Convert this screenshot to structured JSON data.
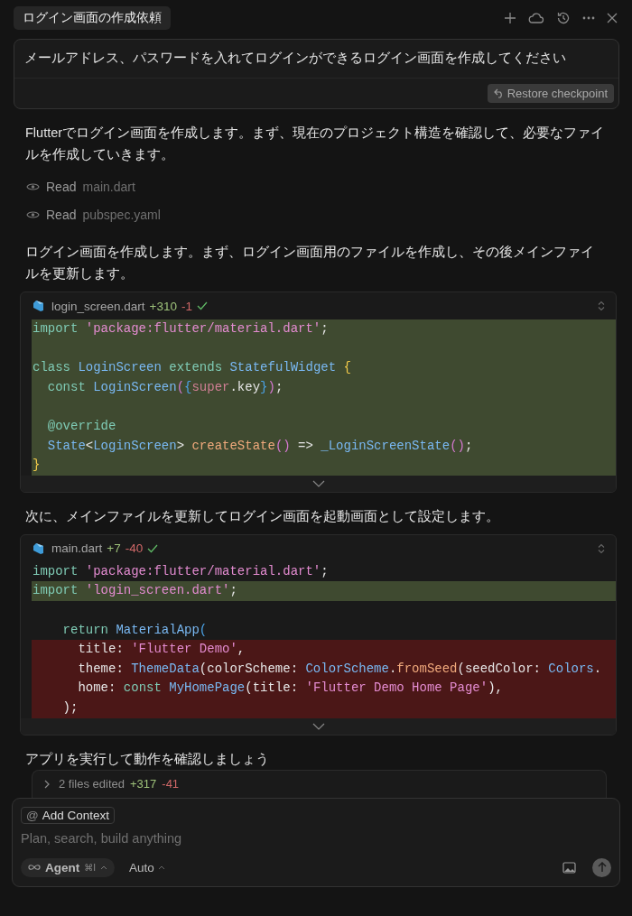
{
  "header": {
    "title": "ログイン画面の作成依頼"
  },
  "user_message": {
    "text": "メールアドレス、パスワードを入れてログインができるログイン画面を作成してください",
    "restore_button": "Restore checkpoint"
  },
  "messages": [
    {
      "kind": "text",
      "text": "Flutterでログイン画面を作成します。まず、現在のプロジェクト構造を確認して、必要なファイルを作成していきます。"
    },
    {
      "kind": "tool",
      "verb": "Read",
      "file": "main.dart"
    },
    {
      "kind": "tool",
      "verb": "Read",
      "file": "pubspec.yaml"
    },
    {
      "kind": "text",
      "text": "ログイン画面を作成します。まず、ログイン画面用のファイルを作成し、その後メインファイルを更新します。"
    },
    {
      "kind": "diff",
      "file": "login_screen.dart",
      "added": "+310",
      "removed": "-1",
      "applied": true,
      "lines": [
        {
          "kind": "added",
          "segments": [
            {
              "kind": "keyword",
              "text": "import "
            },
            {
              "kind": "string",
              "text": "'package:flutter/material.dart'"
            },
            {
              "kind": "plain",
              "text": ";"
            }
          ]
        },
        {
          "kind": "added"
        },
        {
          "kind": "added",
          "segments": [
            {
              "kind": "keyword",
              "text": "class "
            },
            {
              "kind": "type",
              "text": "LoginScreen "
            },
            {
              "kind": "keyword",
              "text": "extends "
            },
            {
              "kind": "type",
              "text": "StatefulWidget "
            },
            {
              "kind": "brace",
              "text": "{"
            }
          ]
        },
        {
          "kind": "added",
          "segments": [
            {
              "kind": "keyword",
              "text": "  const "
            },
            {
              "kind": "type",
              "text": "LoginScreen"
            },
            {
              "kind": "paren",
              "text": "("
            },
            {
              "kind": "brace2",
              "text": "{"
            },
            {
              "kind": "super",
              "text": "super"
            },
            {
              "kind": "plain",
              "text": ".key"
            },
            {
              "kind": "brace2",
              "text": "}"
            },
            {
              "kind": "paren",
              "text": ")"
            },
            {
              "kind": "plain",
              "text": ";"
            }
          ]
        },
        {
          "kind": "added"
        },
        {
          "kind": "added",
          "segments": [
            {
              "kind": "keyword",
              "text": "  @override"
            }
          ]
        },
        {
          "kind": "added",
          "segments": [
            {
              "kind": "type",
              "text": "  State"
            },
            {
              "kind": "plain",
              "text": "<"
            },
            {
              "kind": "type",
              "text": "LoginScreen"
            },
            {
              "kind": "plain",
              "text": "> "
            },
            {
              "kind": "function",
              "text": "createState"
            },
            {
              "kind": "paren",
              "text": "()"
            },
            {
              "kind": "plain",
              "text": " => "
            },
            {
              "kind": "type",
              "text": "_LoginScreenState"
            },
            {
              "kind": "paren",
              "text": "()"
            },
            {
              "kind": "plain",
              "text": ";"
            }
          ]
        },
        {
          "kind": "added",
          "segments": [
            {
              "kind": "brace",
              "text": "}"
            }
          ]
        }
      ]
    },
    {
      "kind": "text",
      "text": "次に、メインファイルを更新してログイン画面を起動画面として設定します。"
    },
    {
      "kind": "diff",
      "file": "main.dart",
      "added": "+7",
      "removed": "-40",
      "applied": true,
      "lines": [
        {
          "kind": "context",
          "segments": [
            {
              "kind": "keyword",
              "text": "import "
            },
            {
              "kind": "string",
              "text": "'package:flutter/material.dart'"
            },
            {
              "kind": "plain",
              "text": ";"
            }
          ]
        },
        {
          "kind": "added",
          "segments": [
            {
              "kind": "keyword",
              "text": "import "
            },
            {
              "kind": "string",
              "text": "'login_screen.dart'"
            },
            {
              "kind": "plain",
              "text": ";"
            }
          ]
        },
        {
          "kind": "context"
        },
        {
          "kind": "context",
          "segments": [
            {
              "kind": "keyword",
              "text": "    return "
            },
            {
              "kind": "type",
              "text": "MaterialApp"
            },
            {
              "kind": "brace2",
              "text": "("
            }
          ]
        },
        {
          "kind": "removed",
          "segments": [
            {
              "kind": "plain",
              "text": "      title: "
            },
            {
              "kind": "string",
              "text": "'Flutter Demo'"
            },
            {
              "kind": "plain",
              "text": ","
            }
          ]
        },
        {
          "kind": "removed",
          "segments": [
            {
              "kind": "plain",
              "text": "      theme: "
            },
            {
              "kind": "type",
              "text": "ThemeData"
            },
            {
              "kind": "plain",
              "text": "(colorScheme: "
            },
            {
              "kind": "type",
              "text": "ColorScheme"
            },
            {
              "kind": "plain",
              "text": "."
            },
            {
              "kind": "function",
              "text": "fromSeed"
            },
            {
              "kind": "plain",
              "text": "(seedColor: "
            },
            {
              "kind": "type",
              "text": "Colors"
            },
            {
              "kind": "plain",
              "text": "."
            }
          ]
        },
        {
          "kind": "removed",
          "segments": [
            {
              "kind": "plain",
              "text": "      home: "
            },
            {
              "kind": "keyword",
              "text": "const "
            },
            {
              "kind": "type",
              "text": "MyHomePage"
            },
            {
              "kind": "plain",
              "text": "(title: "
            },
            {
              "kind": "string",
              "text": "'Flutter Demo Home Page'"
            },
            {
              "kind": "plain",
              "text": "),"
            }
          ]
        },
        {
          "kind": "removed",
          "segments": [
            {
              "kind": "plain",
              "text": "    );"
            }
          ]
        }
      ]
    },
    {
      "kind": "text",
      "text": "アプリを実行して動作を確認しましょう"
    }
  ],
  "edits_summary": {
    "label": "2 files edited",
    "added": "+317",
    "removed": "-41",
    "expanded": false
  },
  "composer": {
    "context_symbol": "@",
    "context_button": "Add Context",
    "placeholder": "Plan, search, build anything",
    "mode": "Agent",
    "shortcut": "⌘I",
    "model": "Auto"
  }
}
